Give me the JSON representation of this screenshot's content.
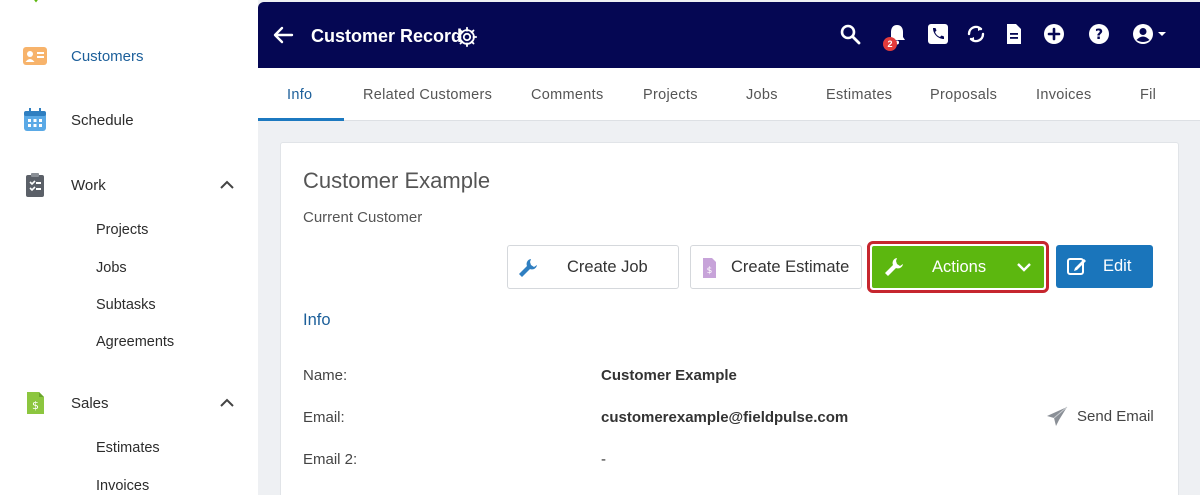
{
  "sidebar": {
    "items": [
      {
        "label": "Customers",
        "icon": "customer-card-icon"
      },
      {
        "label": "Schedule",
        "icon": "calendar-icon"
      },
      {
        "label": "Work",
        "icon": "clipboard-icon"
      },
      {
        "label": "Sales",
        "icon": "dollar-document-icon"
      }
    ],
    "work_subitems": [
      "Projects",
      "Jobs",
      "Subtasks",
      "Agreements"
    ],
    "sales_subitems": [
      "Estimates",
      "Invoices"
    ]
  },
  "topbar": {
    "title": "Customer Record",
    "notification_count": "2",
    "icons": [
      "search-icon",
      "bell-icon",
      "phone-icon",
      "sync-icon",
      "document-icon",
      "plus-circle-icon",
      "help-icon",
      "user-account-icon"
    ]
  },
  "tabs": [
    "Info",
    "Related Customers",
    "Comments",
    "Projects",
    "Jobs",
    "Estimates",
    "Proposals",
    "Invoices",
    "Fil"
  ],
  "customer": {
    "name": "Customer Example",
    "status": "Current Customer"
  },
  "buttons": {
    "create_job": "Create Job",
    "create_estimate": "Create Estimate",
    "actions": "Actions",
    "edit": "Edit",
    "send_email": "Send Email"
  },
  "info": {
    "section_title": "Info",
    "rows": [
      {
        "label": "Name:",
        "value": "Customer Example"
      },
      {
        "label": "Email:",
        "value": "customerexample@fieldpulse.com"
      },
      {
        "label": "Email 2:",
        "value": "-"
      }
    ]
  },
  "colors": {
    "topbar": "#050753",
    "accent_blue": "#1a75bb",
    "actions_green": "#5cb70f",
    "highlight_red": "#c6262e"
  }
}
